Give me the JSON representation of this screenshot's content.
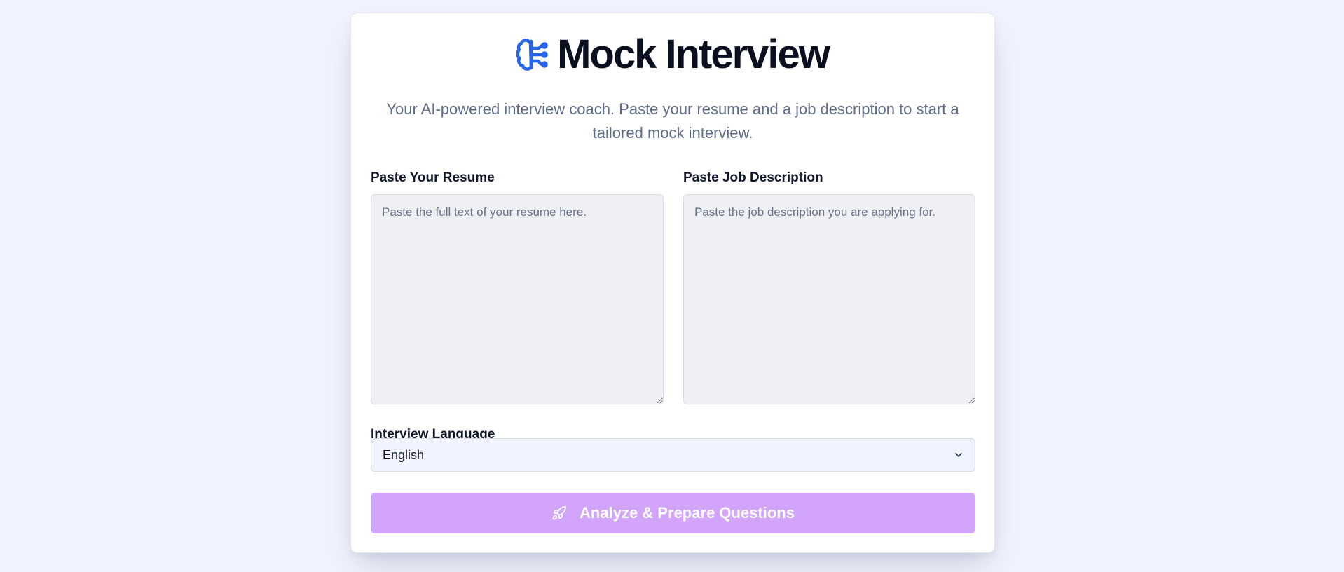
{
  "app": {
    "title": "Mock Interview",
    "subtitle": "Your AI-powered interview coach. Paste your resume and a job description to start a tailored mock interview.",
    "icon": "brain-circuit-icon",
    "accent_color": "#2563eb"
  },
  "resume": {
    "label": "Paste Your Resume",
    "placeholder": "Paste the full text of your resume here.",
    "value": ""
  },
  "job_description": {
    "label": "Paste Job Description",
    "placeholder": "Paste the job description you are applying for.",
    "value": ""
  },
  "language": {
    "label": "Interview Language",
    "selected": "English",
    "icon": "chevron-down-icon"
  },
  "submit": {
    "label": "Analyze & Prepare Questions",
    "icon": "rocket-icon",
    "color": "#d2a4fb",
    "disabled": true
  }
}
